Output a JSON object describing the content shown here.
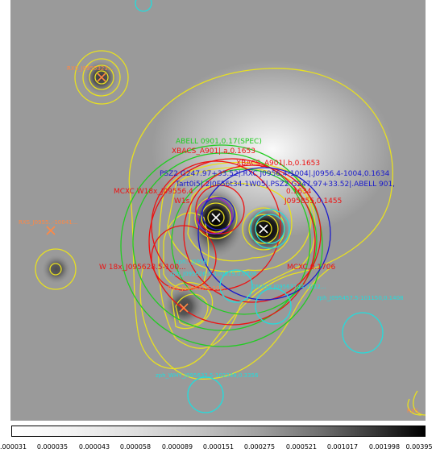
{
  "image": {
    "description_colors": {
      "contour_yellow": "#e8e020",
      "green": "#22cc22",
      "red": "#ee1111",
      "blue": "#1a1acc",
      "cyan": "#22dddd",
      "purple": "#9922cc",
      "orange": "#ff8844"
    },
    "labels": [
      {
        "id": "abell-0901",
        "text": "ABELL 0901,0.17(SPEC)",
        "color": "#22cc22"
      },
      {
        "id": "xbacs-a901-a",
        "text": "XBACS_A901|.a,0.1653",
        "color": "#ee1111"
      },
      {
        "id": "xbacs-a901-b",
        "text": "XBACS_A901|.b,0.1653",
        "color": "#ee1111"
      },
      {
        "id": "psz2",
        "text": "PSZ2 G247.97+33.52|.RXC J0956.4-1004|.J0956.4-1004,0.1634",
        "color": "#1a1acc"
      },
      {
        "id": "tag-mixed",
        "text": "Tart0i5|.2J0F56t34-1W05|.PSZ2 G247.97+33.52|.ABELL 901,",
        "color": "#1a1acc"
      },
      {
        "id": "mcxc-left",
        "text": "MCXC W18x_J09556.4",
        "color": "#ee1111"
      },
      {
        "id": "w18x-ink",
        "text": "W1s",
        "color": "#ee1111"
      },
      {
        "id": "x0634",
        "text": "0.1634",
        "color": "#ee1111"
      },
      {
        "id": "j095855",
        "text": "J095855,0.1455",
        "color": "#ee1111"
      },
      {
        "id": "w18x-j095628",
        "text": "W 18x_J095628.5-100...",
        "color": "#ee1111"
      },
      {
        "id": "mcxc-right",
        "text": "MCXC,0.1706",
        "color": "#ee1111"
      },
      {
        "id": "rxs-j0956",
        "text": "RXS_J095632.5-100...",
        "color": "#ff8844"
      },
      {
        "id": "rxs-top",
        "text": "RXS_J0955323...",
        "color": "#ff8844"
      },
      {
        "id": "rxs-left",
        "text": "RXS_J0955..-10041...",
        "color": "#ff8844"
      },
      {
        "id": "zph-0706",
        "text": "zph_J095626.5-100619,0.0706",
        "color": "#22dddd"
      },
      {
        "id": "zph-right",
        "text": "2MASX J09563744-1012...",
        "color": "#22dddd"
      },
      {
        "id": "zph-far-right",
        "text": "zph_J095457.5-101150,0.1408",
        "color": "#22dddd"
      },
      {
        "id": "zph-whiy",
        "text": "zph_WHY_J095632.5-102249,0.3356",
        "color": "#22dddd"
      },
      {
        "id": "cyan-small-1",
        "text": "zph...J0956..",
        "color": "#22dddd"
      },
      {
        "id": "orange-right-edge",
        "text": "RXS..",
        "color": "#ff8844"
      }
    ]
  },
  "colorbar": {
    "ticks": [
      "0.000031",
      "0.000035",
      "0.000043",
      "0.000058",
      "0.000089",
      "0.000151",
      "0.000275",
      "0.000521",
      "0.001017",
      "0.001998",
      "0.00395"
    ]
  }
}
